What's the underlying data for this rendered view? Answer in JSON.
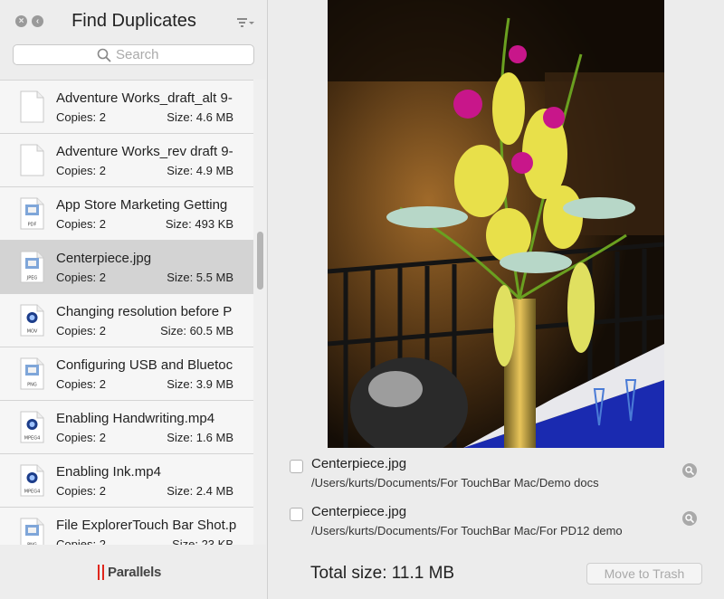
{
  "app": {
    "title": "Find Duplicates",
    "close_glyph": "×",
    "back_glyph": "‹",
    "brand": "Parallels",
    "brand_color": "#e0261b"
  },
  "search": {
    "placeholder": "Search",
    "value": ""
  },
  "files": [
    {
      "name": "Adventure Works_draft_alt 9-",
      "copies": "Copies: 2",
      "size": "Size: 4.6 MB",
      "icon": "blank-document-icon",
      "selected": false
    },
    {
      "name": "Adventure Works_rev draft 9-",
      "copies": "Copies: 2",
      "size": "Size: 4.9 MB",
      "icon": "blank-document-icon",
      "selected": false
    },
    {
      "name": "App Store Marketing Getting",
      "copies": "Copies: 2",
      "size": "Size: 493 KB",
      "icon": "pdf-file-icon",
      "badge": "PDF",
      "selected": false
    },
    {
      "name": "Centerpiece.jpg",
      "copies": "Copies: 2",
      "size": "Size: 5.5 MB",
      "icon": "jpeg-file-icon",
      "badge": "JPEG",
      "selected": true
    },
    {
      "name": "Changing resolution before P",
      "copies": "Copies: 2",
      "size": "Size: 60.5 MB",
      "icon": "mov-file-icon",
      "badge": "MOV",
      "selected": false
    },
    {
      "name": "Configuring USB and Bluetoc",
      "copies": "Copies: 2",
      "size": "Size: 3.9 MB",
      "icon": "png-file-icon",
      "badge": "PNG",
      "selected": false
    },
    {
      "name": "Enabling Handwriting.mp4",
      "copies": "Copies: 2",
      "size": "Size: 1.6 MB",
      "icon": "mpeg4-file-icon",
      "badge": "MPEG4",
      "selected": false
    },
    {
      "name": "Enabling Ink.mp4",
      "copies": "Copies: 2",
      "size": "Size: 2.4 MB",
      "icon": "mpeg4-file-icon",
      "badge": "MPEG4",
      "selected": false
    },
    {
      "name": "File ExplorerTouch Bar Shot.p",
      "copies": "Copies: 2",
      "size": "Size: 23 KB",
      "icon": "png-file-icon",
      "badge": "PNG",
      "selected": false
    }
  ],
  "details": {
    "duplicates": [
      {
        "name": "Centerpiece.jpg",
        "path": "/Users/kurts/Documents/For TouchBar Mac/Demo docs",
        "checked": false
      },
      {
        "name": "Centerpiece.jpg",
        "path": "/Users/kurts/Documents/For TouchBar Mac/For PD12 demo",
        "checked": false
      }
    ],
    "total_size": "Total size: 11.1 MB",
    "trash_label": "Move to Trash"
  }
}
